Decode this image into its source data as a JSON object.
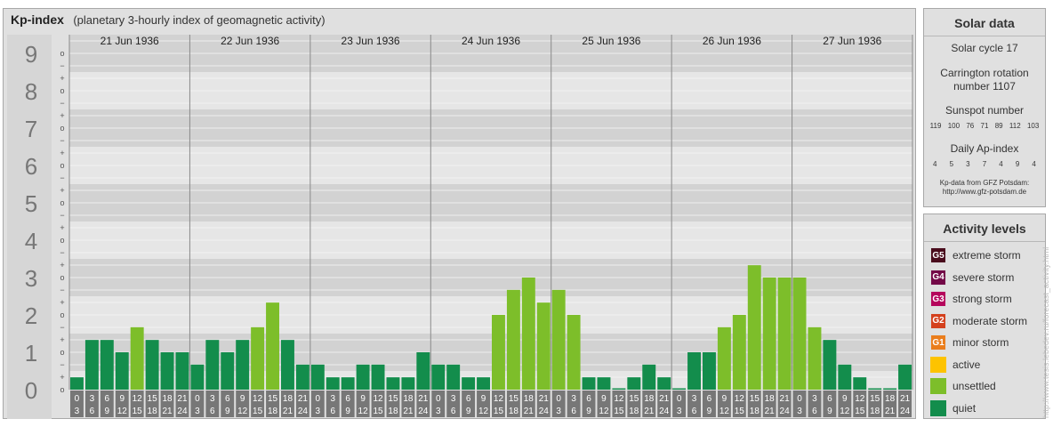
{
  "title": {
    "main": "Kp-index",
    "sub": "(planetary 3-hourly index of geomagnetic activity)"
  },
  "chart_data": {
    "type": "bar",
    "y_levels": [
      "0",
      "1",
      "2",
      "3",
      "4",
      "5",
      "6",
      "7",
      "8",
      "9"
    ],
    "y_minor_labels": [
      "o",
      "+",
      "−"
    ],
    "ylim": [
      0,
      9
    ],
    "days": [
      "21 Jun 1936",
      "22 Jun 1936",
      "23 Jun 1936",
      "24 Jun 1936",
      "25 Jun 1936",
      "26 Jun 1936",
      "27 Jun 1936"
    ],
    "interval_labels": [
      [
        "0",
        "3"
      ],
      [
        "3",
        "6"
      ],
      [
        "6",
        "9"
      ],
      [
        "9",
        "12"
      ],
      [
        "12",
        "15"
      ],
      [
        "15",
        "18"
      ],
      [
        "18",
        "21"
      ],
      [
        "21",
        "24"
      ]
    ],
    "values": [
      [
        0.33,
        1.33,
        1.33,
        1.0,
        1.67,
        1.33,
        1.0,
        1.0
      ],
      [
        0.67,
        1.33,
        1.0,
        1.33,
        1.67,
        2.33,
        1.33,
        0.67
      ],
      [
        0.67,
        0.33,
        0.33,
        0.67,
        0.67,
        0.33,
        0.33,
        1.0
      ],
      [
        0.67,
        0.67,
        0.33,
        0.33,
        2.0,
        2.67,
        3.0,
        2.33
      ],
      [
        2.67,
        2.0,
        0.33,
        0.33,
        0.0,
        0.33,
        0.67,
        0.33
      ],
      [
        0.0,
        1.0,
        1.0,
        1.67,
        2.0,
        3.33,
        3.0,
        3.0
      ],
      [
        3.0,
        1.67,
        1.33,
        0.67,
        0.33,
        0.0,
        0.0,
        0.67
      ]
    ],
    "colors": {
      "quiet": "#138d4c",
      "unsettled": "#7dbe2a",
      "active": "#fdc300",
      "minor": "#ea7d1c",
      "moderate": "#d4401d",
      "strong": "#b5055c",
      "severe": "#730847",
      "extreme": "#490b1c"
    }
  },
  "solar": {
    "title": "Solar data",
    "cycle": "Solar cycle 17",
    "carrington_1": "Carrington rotation",
    "carrington_2": "number 1107",
    "sunspot_label": "Sunspot number",
    "sunspots": [
      "119",
      "100",
      "76",
      "71",
      "89",
      "112",
      "103"
    ],
    "ap_label": "Daily Ap-index",
    "ap": [
      "4",
      "5",
      "3",
      "7",
      "4",
      "9",
      "4"
    ],
    "credit_1": "Kp-data from GFZ Potsdam:",
    "credit_2": "http://www.gfz-potsdam.de"
  },
  "activity": {
    "title": "Activity levels",
    "levels": [
      {
        "code": "G5",
        "label": "extreme storm",
        "color": "#490b1c"
      },
      {
        "code": "G4",
        "label": "severe storm",
        "color": "#730847"
      },
      {
        "code": "G3",
        "label": "strong storm",
        "color": "#b5055c"
      },
      {
        "code": "G2",
        "label": "moderate storm",
        "color": "#d4401d"
      },
      {
        "code": "G1",
        "label": "minor storm",
        "color": "#ea7d1c"
      },
      {
        "code": "",
        "label": "active",
        "color": "#fdc300"
      },
      {
        "code": "",
        "label": "unsettled",
        "color": "#7dbe2a"
      },
      {
        "code": "",
        "label": "quiet",
        "color": "#138d4c"
      }
    ]
  },
  "watermark": "http://www.tesis.lebedev.ru/forecast_activity.html"
}
